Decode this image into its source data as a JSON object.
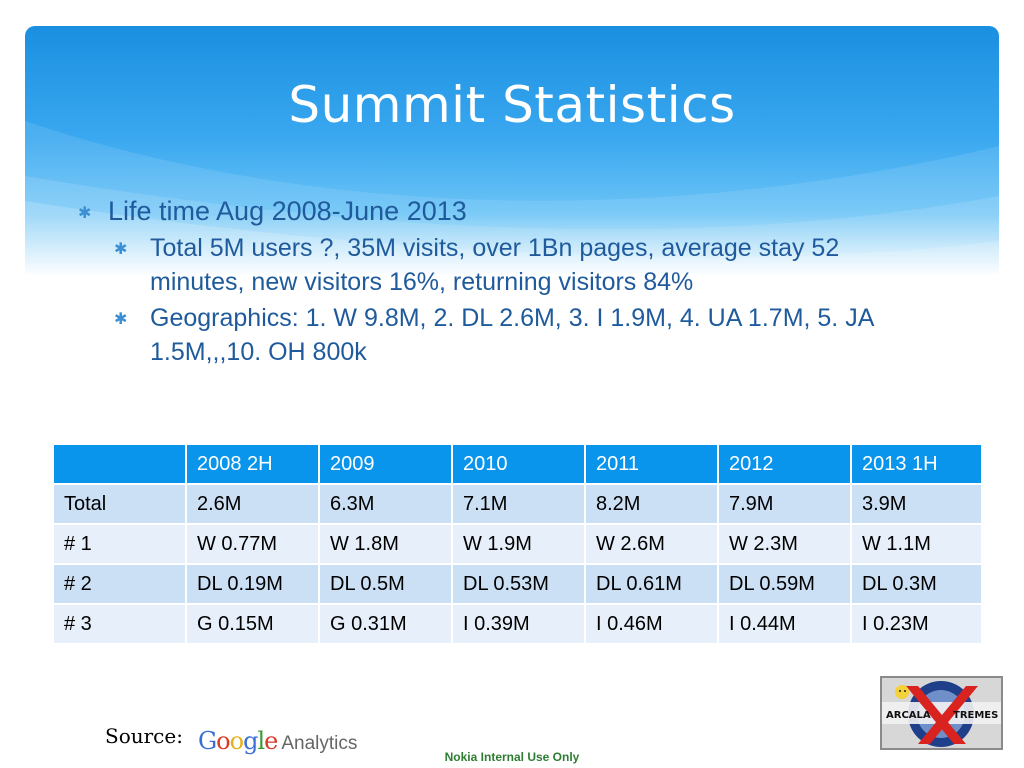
{
  "slide": {
    "title": "Summit Statistics",
    "bullets": [
      {
        "text": "Life time Aug 2008-June 2013"
      },
      {
        "text": "Total 5M users ?, 35M visits, over 1Bn pages, average stay 52 minutes, new visitors 16%, returning visitors 84%"
      },
      {
        "text": "Geographics: 1. W 9.8M, 2. DL 2.6M, 3. I 1.9M, 4. UA 1.7M, 5. JA 1.5M,,,10. OH 800k"
      }
    ],
    "bullet_icon": "asterisk-icon"
  },
  "table": {
    "header": [
      "",
      "2008 2H",
      "2009",
      "2010",
      "2011",
      "2012",
      "2013 1H"
    ],
    "rows": [
      [
        "Total",
        "2.6M",
        "6.3M",
        "7.1M",
        "8.2M",
        "7.9M",
        "3.9M"
      ],
      [
        "# 1",
        "W 0.77M",
        "W 1.8M",
        "W 1.9M",
        "W 2.6M",
        "W 2.3M",
        "W 1.1M"
      ],
      [
        "# 2",
        "DL 0.19M",
        "DL 0.5M",
        "DL 0.53M",
        "DL 0.61M",
        "DL 0.59M",
        "DL 0.3M"
      ],
      [
        "# 3",
        "G 0.15M",
        "G 0.31M",
        "I 0.39M",
        "I 0.46M",
        "I 0.44M",
        "I 0.23M"
      ]
    ]
  },
  "footer": {
    "source_label": "Source:",
    "analytics_logo": {
      "letters": [
        {
          "ch": "G",
          "color": "#3b6fd8"
        },
        {
          "ch": "o",
          "color": "#d93a2b"
        },
        {
          "ch": "o",
          "color": "#e8b01b"
        },
        {
          "ch": "g",
          "color": "#3b6fd8"
        },
        {
          "ch": "l",
          "color": "#3a9a3a"
        },
        {
          "ch": "e",
          "color": "#d93a2b"
        }
      ],
      "suffix": "Analytics"
    },
    "notice": "Nokia Internal Use Only",
    "badge_logo_text": "ARCALA XTREMES"
  },
  "colors": {
    "header_blue": "#1a8fe0",
    "bullet_text": "#1f5b9c",
    "table_header": "#0a95ec",
    "table_row_odd": "#cbdff5",
    "table_row_even": "#e7f0fa",
    "notice_green": "#2e7d32"
  }
}
